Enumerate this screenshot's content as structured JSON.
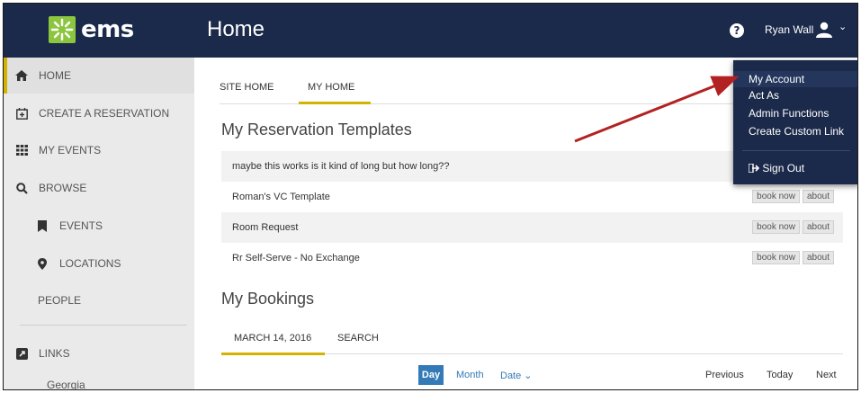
{
  "app": {
    "logo_text": "ems",
    "page_title": "Home"
  },
  "header": {
    "help_glyph": "?",
    "user_name": "Ryan Wall",
    "caret": "⌄"
  },
  "sidebar": {
    "items": [
      {
        "label": "HOME",
        "icon": "home-icon"
      },
      {
        "label": "CREATE A RESERVATION",
        "icon": "calendar-plus-icon"
      },
      {
        "label": "MY EVENTS",
        "icon": "grid-icon"
      },
      {
        "label": "BROWSE",
        "icon": "search-icon"
      },
      {
        "label": "EVENTS",
        "icon": "bookmark-icon"
      },
      {
        "label": "LOCATIONS",
        "icon": "map-marker-icon"
      },
      {
        "label": "PEOPLE"
      },
      {
        "label": "LINKS",
        "icon": "external-link-icon"
      },
      {
        "label": "Georgia"
      }
    ]
  },
  "main": {
    "tabs": [
      {
        "label": "SITE HOME"
      },
      {
        "label": "MY HOME"
      }
    ],
    "templates_title": "My Reservation Templates",
    "templates": [
      {
        "name": "maybe this works is it kind of long but how long??"
      },
      {
        "name": "Roman's VC Template",
        "book": "book now",
        "about": "about"
      },
      {
        "name": "Room Request",
        "book": "book now",
        "about": "about"
      },
      {
        "name": "Rr Self-Serve - No Exchange",
        "book": "book now",
        "about": "about"
      }
    ],
    "bookings_title": "My Bookings",
    "booking_tabs": [
      {
        "label": "MARCH 14, 2016"
      },
      {
        "label": "SEARCH"
      }
    ],
    "views": {
      "day": "Day",
      "month": "Month",
      "date": "Date ⌄"
    },
    "pager": {
      "previous": "Previous",
      "today": "Today",
      "next": "Next"
    }
  },
  "dropdown": {
    "items": [
      {
        "label": "My Account"
      },
      {
        "label": "Act As"
      },
      {
        "label": "Admin Functions"
      },
      {
        "label": "Create Custom Link"
      },
      {
        "label": "Sign Out",
        "icon": "sign-out-icon"
      }
    ]
  },
  "colors": {
    "header": "#1b2a4a",
    "accent": "#d4b300",
    "logo_green": "#8cc63f",
    "link": "#337ab7",
    "arrow": "#b22222"
  }
}
